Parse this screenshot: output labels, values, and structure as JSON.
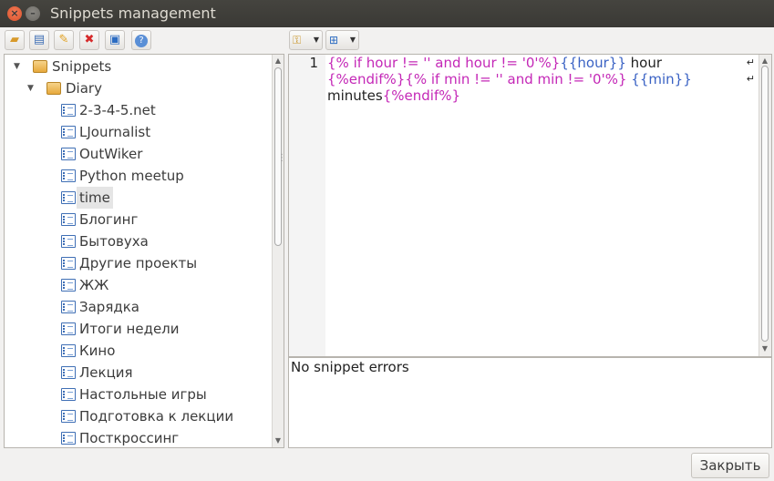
{
  "window": {
    "title": "Snippets management"
  },
  "toolbar": {
    "buttons": [
      {
        "name": "add-folder-button",
        "glyph": "📁"
      },
      {
        "name": "add-snippet-button",
        "glyph": "📘"
      },
      {
        "name": "rename-button",
        "glyph": "✎"
      },
      {
        "name": "remove-button",
        "glyph": "✖"
      },
      {
        "name": "run-button",
        "glyph": "▣"
      },
      {
        "name": "help-button",
        "glyph": "?"
      }
    ]
  },
  "tree": {
    "root": "Snippets",
    "folder": "Diary",
    "items": [
      "2-3-4-5.net",
      "LJournalist",
      "OutWiker",
      "Python meetup",
      "time",
      "Блогинг",
      "Бытовуха",
      "Другие проекты",
      "ЖЖ",
      "Зарядка",
      "Итоги недели",
      "Кино",
      "Лекция",
      "Настольные игры",
      "Подготовка к лекции",
      "Посткроссинг"
    ],
    "selected": "time"
  },
  "editor": {
    "line_number": "1",
    "line1": {
      "a": "{% if hour != '' and hour != '0'%}",
      "b": "{{hour}}",
      "c": " hour"
    },
    "line2": {
      "a": "{%endif%}",
      "b": "{% if min != '' and min != '0'%}",
      "c": " ",
      "d": "{{min}}"
    },
    "line3": {
      "a": "minutes",
      "b": "{%endif%}"
    }
  },
  "errors": {
    "message": "No snippet errors"
  },
  "footer": {
    "close_label": "Закрыть"
  }
}
